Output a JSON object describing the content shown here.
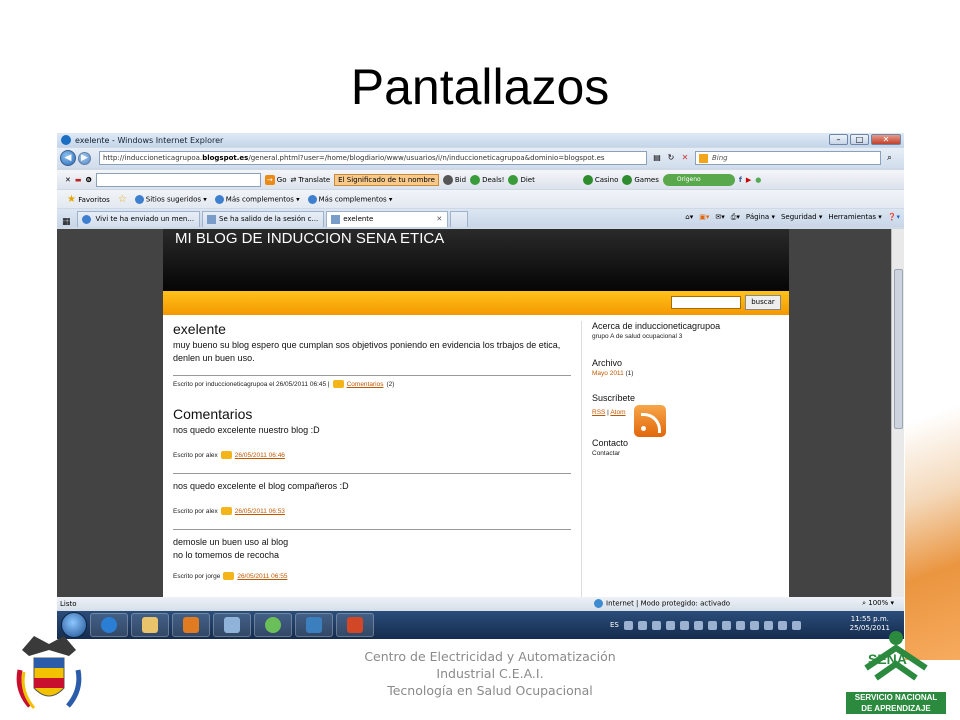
{
  "slide_title": "Pantallazos",
  "window": {
    "title": "exelente - Windows Internet Explorer",
    "buttons": {
      "minimize": "–",
      "maximize": "□",
      "close": "✕"
    }
  },
  "address_bar": {
    "url_prefix": "http://induccioneticagrupoa.",
    "url_domain": "blogspot.es",
    "url_rest": "/general.phtml?user=/home/blogdiario/www/usuarios/i/n/induccioneticagrupoa&dominio=blogspot.es",
    "search_placeholder": "Bing"
  },
  "toolbar": {
    "close": "✕",
    "go": "Go",
    "translate": "Translate",
    "significado": "El Significado de tu nombre",
    "bid": "Bid",
    "deals": "Deals!",
    "diet": "Diet",
    "casino": "Casino",
    "games": "Games",
    "origen": "Origeno"
  },
  "favorites_bar": {
    "favorites": "Favoritos",
    "items": [
      "Sitios sugeridos ▾",
      "Más complementos ▾",
      "Más complementos ▾"
    ]
  },
  "tabs": [
    {
      "label": "Vivi te ha enviado un men..."
    },
    {
      "label": "Se ha salido de la sesión c..."
    },
    {
      "label": "exelente"
    }
  ],
  "command_bar": {
    "page": "Página ▾",
    "security": "Seguridad ▾",
    "tools": "Herramientas ▾"
  },
  "blog": {
    "header": "MI BLOG DE INDUCCION SENA ETICA",
    "search_button": "buscar",
    "post": {
      "title": "exelente",
      "body": "muy bueno su blog espero que cumplan sos objetivos poniendo en evidencia los trbajos de etica, denlen un buen uso.",
      "meta_prefix": "Escrito por induccioneticagrupoa el 26/05/2011 06:45 |",
      "comments_link": "Comentarios",
      "comments_count": "(2)"
    },
    "comments_title": "Comentarios",
    "comments": [
      {
        "text": "nos quedo excelente nuestro blog :D",
        "author": "Escrito por alex",
        "date": "26/05/2011 06:46"
      },
      {
        "text": "nos quedo excelente el blog compañeros :D",
        "author": "Escrito por alex",
        "date": "26/05/2011 06:53"
      },
      {
        "text_line1": "demosle un buen uso al blog",
        "text_line2": "no lo tomemos de recocha",
        "author": "Escrito por jorge",
        "date": "26/05/2011 06:55"
      }
    ],
    "sidebar": {
      "about_title": "Acerca de induccioneticagrupoa",
      "about_text": "grupo A de salud ocupacional 3",
      "archive_title": "Archivo",
      "archive_link": "Mayo 2011",
      "archive_count": "(1)",
      "subscribe_title": "Suscríbete",
      "rss": "RSS",
      "atom": "Atom",
      "contact_title": "Contacto",
      "contact_link": "Contactar"
    }
  },
  "status_bar": {
    "status": "Listo",
    "zone": "Internet | Modo protegido: activado",
    "zoom": "100%"
  },
  "taskbar": {
    "lang": "ES",
    "time": "11:55 p.m.",
    "date": "25/05/2011"
  },
  "footer": {
    "line1": "Centro de Electricidad y Automatización",
    "line2": "Industrial C.E.A.I.",
    "line3": "Tecnología en Salud Ocupacional"
  },
  "sena_logo": {
    "name": "SENA",
    "line1": "SERVICIO NACIONAL",
    "line2": "DE APRENDIZAJE"
  },
  "colors": {
    "blog_orange": "#f49800",
    "link": "#c25700",
    "sena_green": "#2b8a3e"
  }
}
